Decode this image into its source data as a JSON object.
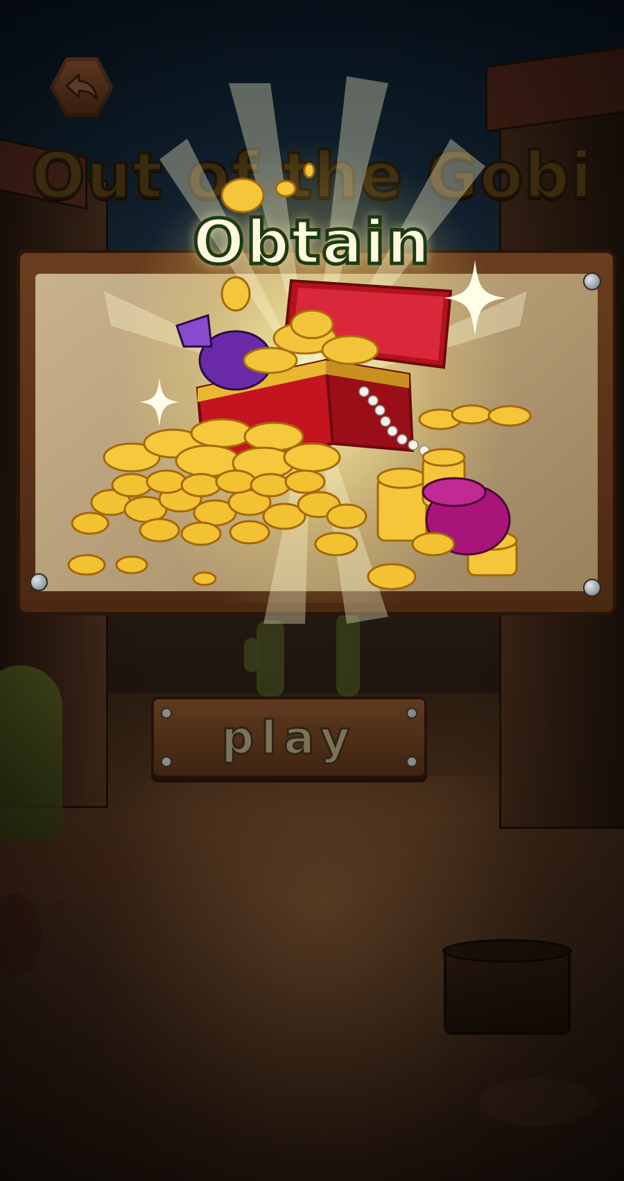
{
  "header": {
    "back_icon": "back-arrow-icon"
  },
  "title": {
    "main": "Out of the Gobi",
    "sub": "Obtain"
  },
  "reward": {
    "image": "treasure-chest-gold-icon"
  },
  "actions": {
    "play_label": "play"
  },
  "colors": {
    "title_text": "#3a2a0e",
    "obtain_text": "#fff7e0",
    "obtain_outline": "#1e3a10",
    "wood": "#5f3a1f",
    "gold": "#f2c230"
  }
}
